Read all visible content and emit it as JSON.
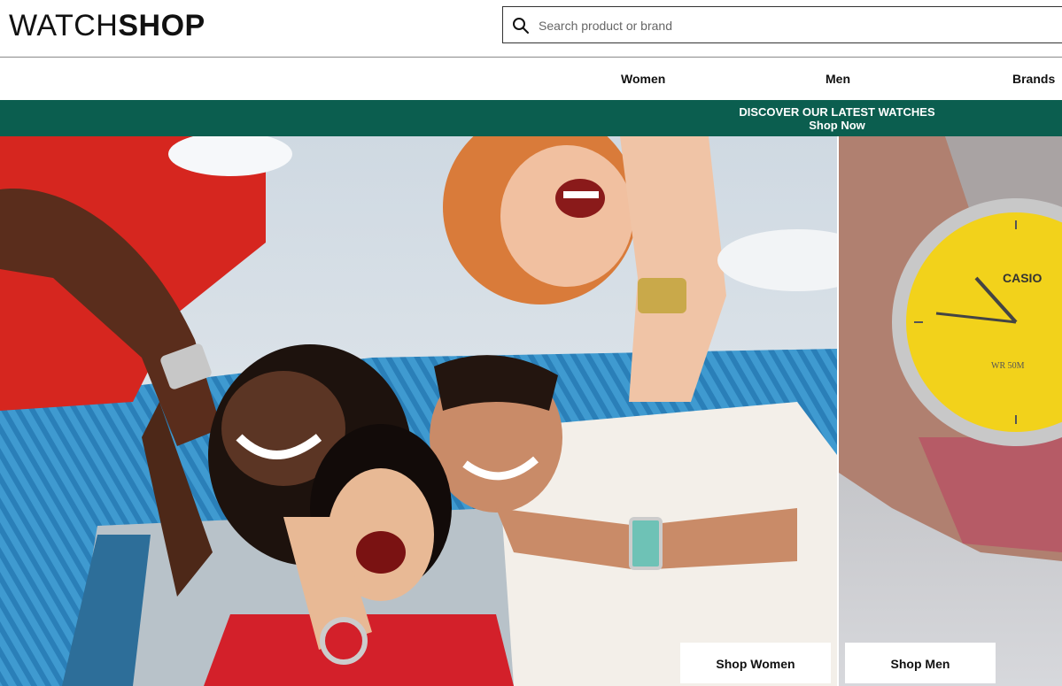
{
  "header": {
    "logo_light": "WATCH",
    "logo_bold": "SHOP",
    "search_placeholder": "Search product or brand"
  },
  "nav": {
    "items": [
      {
        "label": "Women"
      },
      {
        "label": "Men"
      },
      {
        "label": "Brands"
      }
    ]
  },
  "promo": {
    "headline": "DISCOVER OUR LATEST WATCHES",
    "link": "Shop Now",
    "color": "#0b5e4f"
  },
  "hero": {
    "watch_brand_text": "CASIO",
    "watch_dial_text": "WR 50M",
    "buttons": {
      "women": "Shop Women",
      "men": "Shop Men"
    }
  },
  "icons": [
    "search-icon"
  ]
}
